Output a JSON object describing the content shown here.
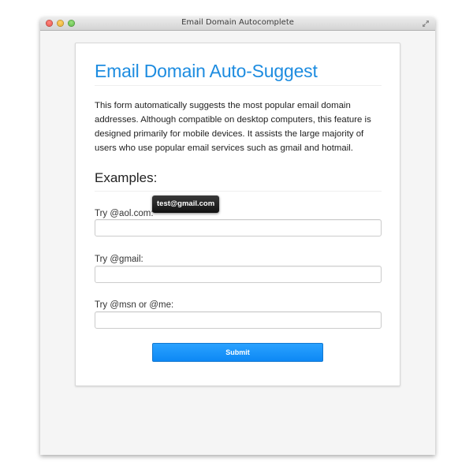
{
  "window": {
    "title": "Email Domain Autocomplete"
  },
  "page": {
    "heading": "Email Domain Auto-Suggest",
    "description": "This form automatically suggests the most popular email domain addresses. Although compatible on desktop computers, this feature is designed primarily for mobile devices. It assists the large majority of users who use popular email services such as gmail and hotmail.",
    "examples_heading": "Examples:"
  },
  "fields": [
    {
      "label": "Try @aol.com:",
      "value": "",
      "placeholder": ""
    },
    {
      "label": "Try @gmail:",
      "value": "",
      "placeholder": ""
    },
    {
      "label": "Try @msn or @me:",
      "value": "",
      "placeholder": ""
    }
  ],
  "suggestion": {
    "text": "test@gmail.com"
  },
  "submit": {
    "label": "Submit"
  },
  "icons": {
    "close": "close-icon",
    "minimize": "minimize-icon",
    "maximize": "maximize-icon",
    "fullscreen": "fullscreen-icon"
  },
  "colors": {
    "accent": "#1d8ce0",
    "button": "#1590f8",
    "tooltip": "#1a1a1a"
  }
}
